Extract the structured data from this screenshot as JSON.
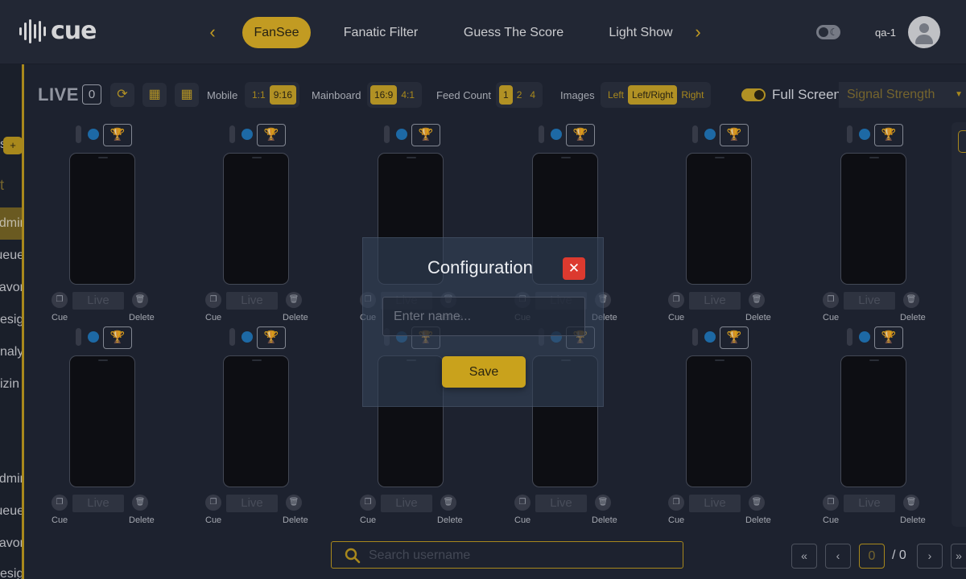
{
  "header": {
    "logo_text": "cue",
    "tabs": [
      {
        "label": "FanSee",
        "active": true
      },
      {
        "label": "Fanatic Filter",
        "active": false
      },
      {
        "label": "Guess The Score",
        "active": false
      },
      {
        "label": "Light Show",
        "active": false
      }
    ],
    "prev_icon": "chevron-left-icon",
    "next_icon": "chevron-right-icon",
    "theme_toggle_icon": "moon-icon",
    "user": {
      "name": "qa-1",
      "avatar_icon": "user-avatar-icon"
    }
  },
  "sidebar": {
    "items": [
      {
        "text": "s"
      },
      {
        "text": "t"
      },
      {
        "text": "dmir",
        "active": true
      },
      {
        "text": "ueue"
      },
      {
        "text": "avor"
      },
      {
        "text": "esig"
      },
      {
        "text": "naly"
      },
      {
        "text": "izin"
      },
      {
        "text": "dmir"
      },
      {
        "text": "ueue"
      },
      {
        "text": "avor"
      },
      {
        "text": "esig"
      }
    ],
    "plus_label": "+"
  },
  "toolbar": {
    "live_label": "LIVE",
    "live_count": "0",
    "mobile_label": "Mobile",
    "mobile_options": [
      {
        "label": "1:1",
        "on": false
      },
      {
        "label": "9:16",
        "on": true
      }
    ],
    "mainboard_label": "Mainboard",
    "mainboard_options": [
      {
        "label": "16:9",
        "on": true
      },
      {
        "label": "4:1",
        "on": false
      }
    ],
    "feed_count_label": "Feed Count",
    "feed_count_options": [
      {
        "label": "1",
        "on": true
      },
      {
        "label": "2",
        "on": false
      },
      {
        "label": "4",
        "on": false
      }
    ],
    "images_label": "Images",
    "images_options": [
      {
        "label": "Left",
        "on": false
      },
      {
        "label": "Left/Right",
        "on": true
      },
      {
        "label": "Right",
        "on": false
      }
    ],
    "full_screen_label": "Full Screen",
    "full_screen_on": true,
    "signal_select_value": "Signal Strength"
  },
  "cards": {
    "live_label": "Live",
    "cue_label": "Cue",
    "delete_label": "Delete",
    "count": 12
  },
  "search": {
    "placeholder": "Search username"
  },
  "pagination": {
    "current": "0",
    "total": "/ 0"
  },
  "modal": {
    "title": "Configuration",
    "input_placeholder": "Enter name...",
    "save_label": "Save",
    "close_label": "✕"
  },
  "colors": {
    "accent": "#e8b923",
    "background": "#1f2533",
    "close_red": "#dc3a2f",
    "status_dot": "#1f7cc2"
  }
}
